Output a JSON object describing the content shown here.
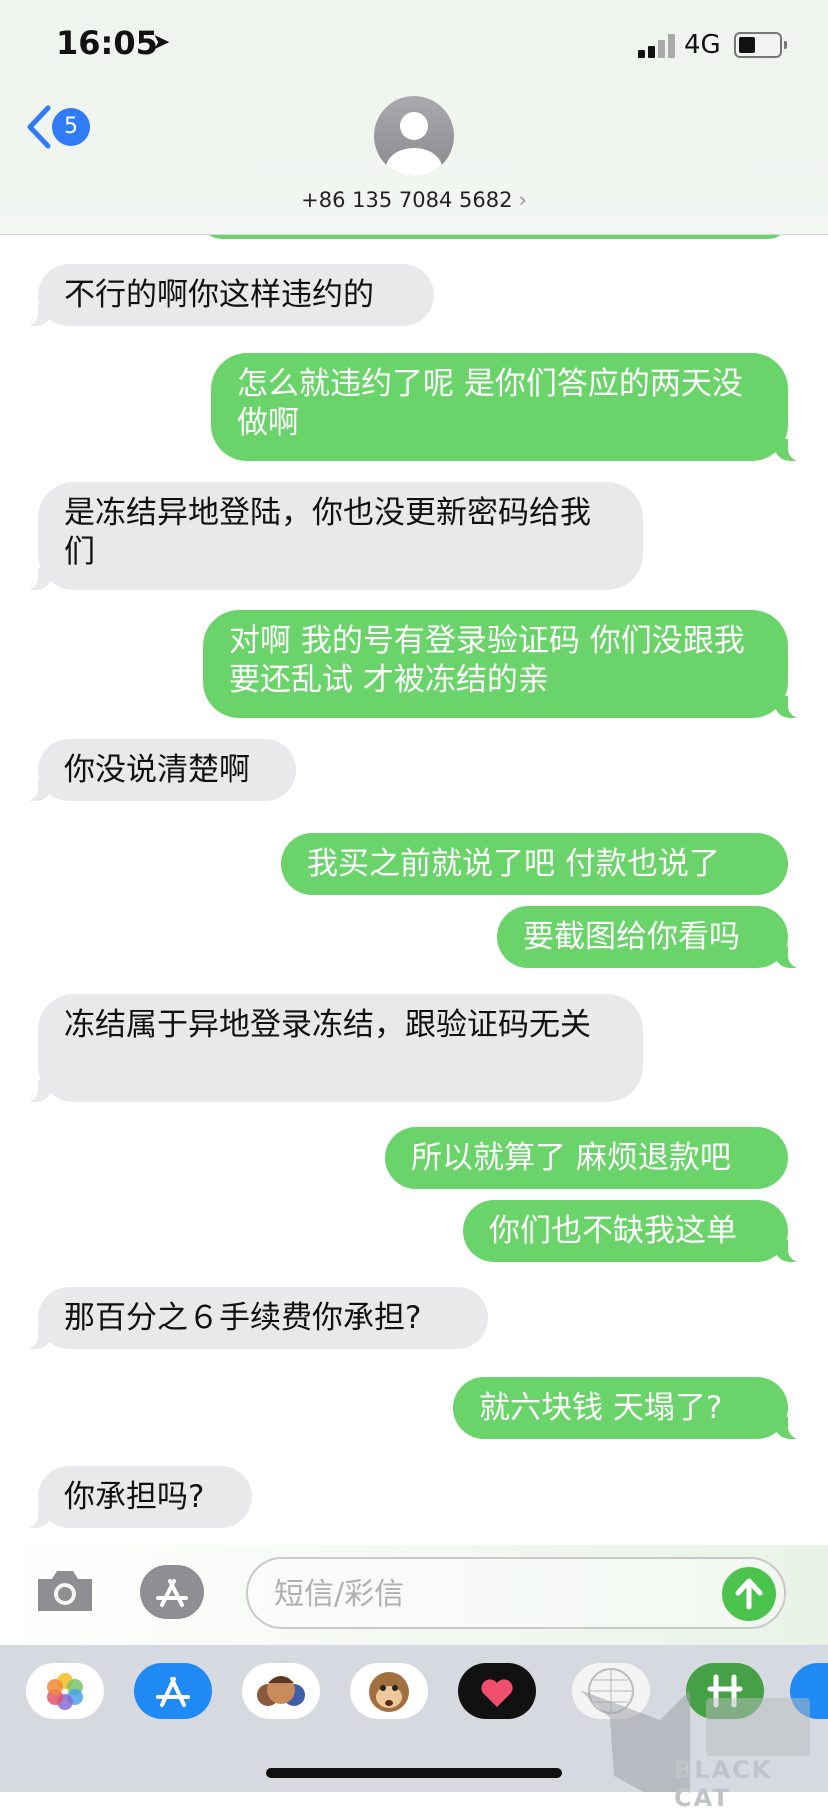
{
  "status_bar": {
    "time": "16:05",
    "network": "4G"
  },
  "header": {
    "back_badge": "5",
    "contact": "+86 135 7084 5682",
    "chevron": "›"
  },
  "messages": [
    {
      "dir": "in",
      "text": "不行的啊你这样违约的"
    },
    {
      "dir": "out",
      "text": "怎么就违约了呢 是你们答应的两天没做啊"
    },
    {
      "dir": "in",
      "text": "是冻结异地登陆，你也没更新密码给我们"
    },
    {
      "dir": "out",
      "text": "对啊 我的号有登录验证码 你们没跟我要还乱试 才被冻结的亲"
    },
    {
      "dir": "in",
      "text": "你没说清楚啊"
    },
    {
      "dir": "out",
      "text": "我买之前就说了吧 付款也说了"
    },
    {
      "dir": "out",
      "text": "要截图给你看吗"
    },
    {
      "dir": "in",
      "text": "冻结属于异地登录冻结，跟验证码无关"
    },
    {
      "dir": "out",
      "text": "所以就算了 麻烦退款吧"
    },
    {
      "dir": "out",
      "text": "你们也不缺我这单"
    },
    {
      "dir": "in",
      "text": "那百分之６手续费你承担?"
    },
    {
      "dir": "out",
      "text": "就六块钱  天塌了?"
    },
    {
      "dir": "in",
      "text": "你承担吗?"
    }
  ],
  "composer": {
    "placeholder": "短信/彩信"
  },
  "app_drawer": [
    "photos-app",
    "app-store-app",
    "memoji-app",
    "animoji-monkey-app",
    "digital-touch-app",
    "grid-app",
    "green-app",
    "blue-app"
  ],
  "watermark": {
    "brand": "BLACK CAT"
  },
  "colors": {
    "incoming": "#e9e9eb",
    "outgoing": "#6ad36a",
    "badge": "#2f7cf6",
    "send": "#4cc34c"
  }
}
